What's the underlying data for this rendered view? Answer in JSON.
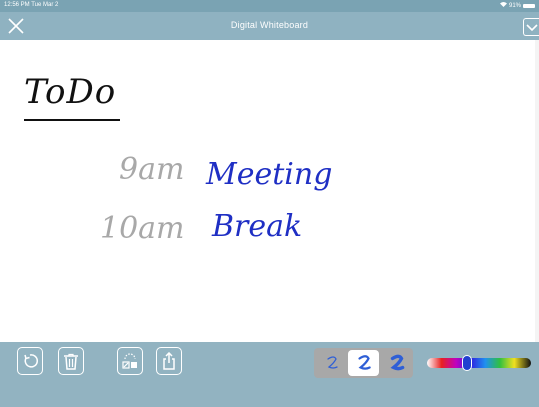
{
  "status_bar": {
    "time": "12:56 PM  Tue Mar 2",
    "battery": "91%"
  },
  "title_bar": {
    "title": "Digital Whiteboard",
    "close_icon": "close-icon",
    "collapse_icon": "chevron-down-icon"
  },
  "whiteboard": {
    "heading": "ToDo",
    "items": [
      {
        "time": "9am",
        "task": "Meeting"
      },
      {
        "time": "10am",
        "task": "Break"
      }
    ],
    "ink_colors": {
      "black": "#111111",
      "gray": "#a8a8a8",
      "blue": "#1f2fc4"
    }
  },
  "toolbar": {
    "undo_icon": "undo-icon",
    "trash_icon": "trash-icon",
    "clear_icon": "clear-canvas-icon",
    "share_icon": "share-icon",
    "pens": [
      "pen-thin-icon",
      "pen-medium-icon",
      "pen-thick-icon"
    ],
    "active_pen": 1,
    "color_slider_value": 0.38,
    "selected_color": "#2040d0"
  }
}
